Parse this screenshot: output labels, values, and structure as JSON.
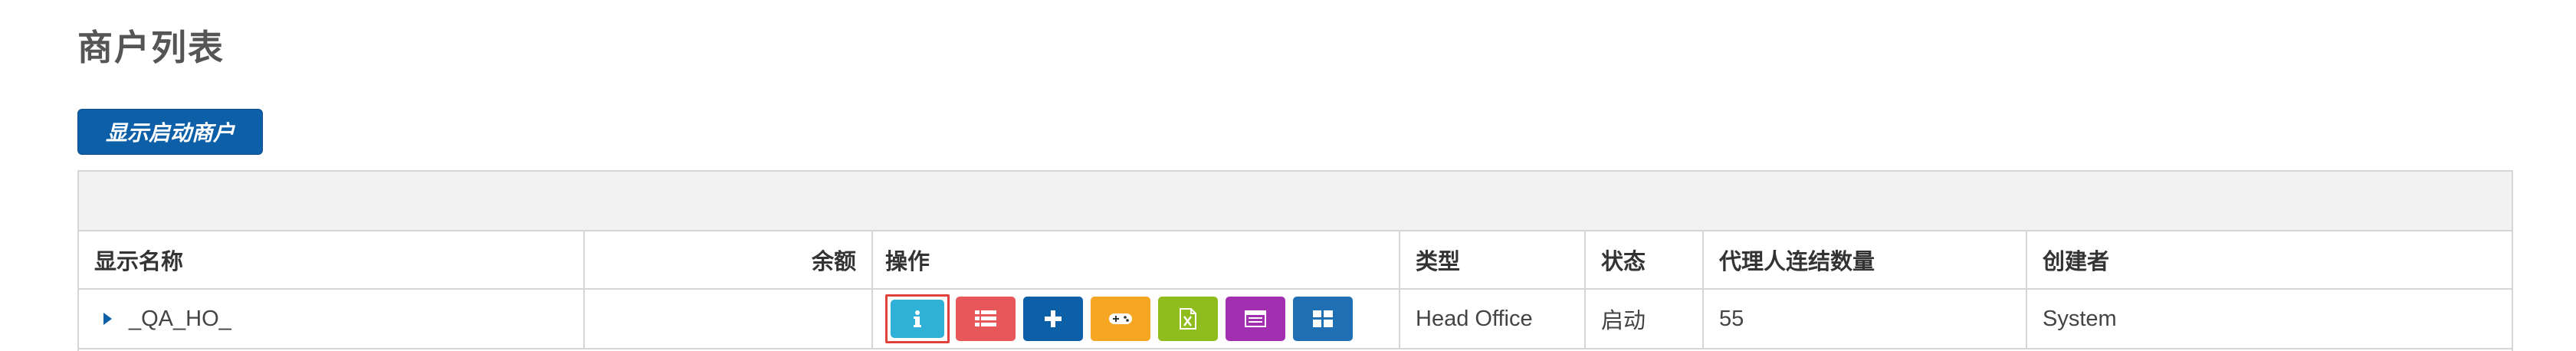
{
  "page": {
    "title": "商户列表",
    "show_active_label": "显示启动商户"
  },
  "table": {
    "columns": [
      "显示名称",
      "余额",
      "操作",
      "类型",
      "状态",
      "代理人连结数量",
      "创建者"
    ],
    "rows": [
      {
        "display_name": "_QA_HO_",
        "balance": "",
        "type": "Head Office",
        "status": "启动",
        "agent_link_count": "55",
        "creator": "System"
      }
    ],
    "action_buttons": [
      {
        "icon": "info-icon",
        "color": "#2fb0d6"
      },
      {
        "icon": "list-icon",
        "color": "#e8585a"
      },
      {
        "icon": "plus-icon",
        "color": "#0d5fa8"
      },
      {
        "icon": "gamepad-icon",
        "color": "#f5a623"
      },
      {
        "icon": "excel-icon",
        "color": "#8fbd1e"
      },
      {
        "icon": "window-icon",
        "color": "#a22fb0"
      },
      {
        "icon": "grid-icon",
        "color": "#1e6fb3"
      }
    ]
  },
  "colors": {
    "primary": "#0d5fa8",
    "border": "#d6d6d6",
    "highlight": "#e0413b"
  }
}
